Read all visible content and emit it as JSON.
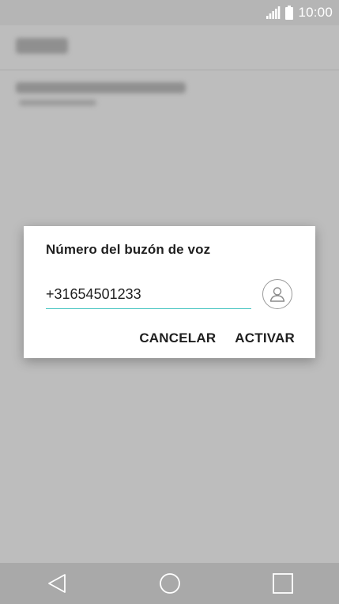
{
  "status_bar": {
    "time": "10:00",
    "signal_icon": "signal-icon",
    "battery_icon": "battery-icon"
  },
  "dialog": {
    "title": "Número del buzón de voz",
    "input_value": "+31654501233",
    "contact_icon": "contact-person-icon",
    "cancel_label": "CANCELAR",
    "confirm_label": "ACTIVAR"
  },
  "nav_bar": {
    "back_icon": "back-triangle-icon",
    "home_icon": "home-circle-icon",
    "recents_icon": "recents-square-icon"
  },
  "colors": {
    "scrim_background": "#bdbdbd",
    "dialog_background": "#ffffff",
    "input_underline": "#3fc2bf",
    "text_primary": "#1f1f1f",
    "nav_bar_background": "#a9a9a9"
  }
}
